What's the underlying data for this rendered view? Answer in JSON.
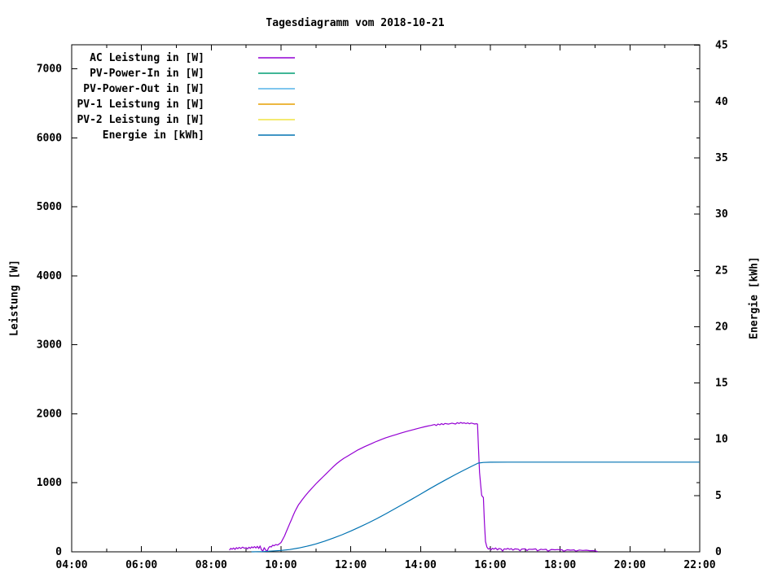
{
  "chart_data": {
    "type": "line",
    "title": "Tagesdiagramm vom 2018-10-21",
    "grid": false,
    "legend_position": "top-left-inside",
    "x_axis": {
      "range_hours": [
        4,
        22
      ],
      "major_tick_hours": [
        4,
        6,
        8,
        10,
        12,
        14,
        16,
        18,
        20,
        22
      ],
      "minor_tick_hours": [
        5,
        7,
        9,
        11,
        13,
        15,
        17,
        19,
        21
      ],
      "tick_labels": [
        "04:00",
        "06:00",
        "08:00",
        "10:00",
        "12:00",
        "14:00",
        "16:00",
        "18:00",
        "20:00",
        "22:00"
      ]
    },
    "y_left": {
      "label": "Leistung [W]",
      "ticks": [
        0,
        1000,
        2000,
        3000,
        4000,
        5000,
        6000,
        7000
      ],
      "max_value": 7348
    },
    "y_right": {
      "label": "Energie [kWh]",
      "ticks": [
        0,
        5,
        10,
        15,
        20,
        25,
        30,
        35,
        40,
        45
      ],
      "max_value": 45.05
    },
    "series": [
      {
        "name": "AC Leistung in [W]",
        "color": "#9400d3",
        "axis": "left",
        "points": [
          [
            8.52,
            25
          ],
          [
            8.56,
            50
          ],
          [
            8.6,
            38
          ],
          [
            8.64,
            55
          ],
          [
            8.68,
            34
          ],
          [
            8.72,
            60
          ],
          [
            8.76,
            45
          ],
          [
            8.8,
            64
          ],
          [
            8.85,
            48
          ],
          [
            8.9,
            68
          ],
          [
            8.95,
            52
          ],
          [
            9.0,
            60
          ],
          [
            9.04,
            42
          ],
          [
            9.08,
            66
          ],
          [
            9.12,
            50
          ],
          [
            9.16,
            72
          ],
          [
            9.2,
            58
          ],
          [
            9.24,
            76
          ],
          [
            9.28,
            55
          ],
          [
            9.32,
            80
          ],
          [
            9.36,
            48
          ],
          [
            9.4,
            85
          ],
          [
            9.44,
            30
          ],
          [
            9.48,
            12
          ],
          [
            9.52,
            60
          ],
          [
            9.56,
            25
          ],
          [
            9.6,
            10
          ],
          [
            9.64,
            55
          ],
          [
            9.68,
            78
          ],
          [
            9.72,
            70
          ],
          [
            9.76,
            95
          ],
          [
            9.8,
            88
          ],
          [
            9.85,
            105
          ],
          [
            9.9,
            98
          ],
          [
            9.95,
            115
          ],
          [
            10.0,
            135
          ],
          [
            10.05,
            180
          ],
          [
            10.1,
            230
          ],
          [
            10.15,
            290
          ],
          [
            10.2,
            350
          ],
          [
            10.25,
            410
          ],
          [
            10.3,
            470
          ],
          [
            10.35,
            530
          ],
          [
            10.4,
            585
          ],
          [
            10.45,
            635
          ],
          [
            10.5,
            680
          ],
          [
            10.55,
            715
          ],
          [
            10.6,
            750
          ],
          [
            10.7,
            815
          ],
          [
            10.8,
            875
          ],
          [
            10.9,
            930
          ],
          [
            11.0,
            985
          ],
          [
            11.1,
            1035
          ],
          [
            11.2,
            1085
          ],
          [
            11.3,
            1135
          ],
          [
            11.4,
            1185
          ],
          [
            11.5,
            1235
          ],
          [
            11.6,
            1280
          ],
          [
            11.7,
            1320
          ],
          [
            11.8,
            1355
          ],
          [
            11.9,
            1385
          ],
          [
            12.0,
            1415
          ],
          [
            12.1,
            1445
          ],
          [
            12.2,
            1475
          ],
          [
            12.3,
            1500
          ],
          [
            12.4,
            1525
          ],
          [
            12.5,
            1548
          ],
          [
            12.6,
            1570
          ],
          [
            12.7,
            1592
          ],
          [
            12.8,
            1612
          ],
          [
            12.9,
            1632
          ],
          [
            13.0,
            1652
          ],
          [
            13.1,
            1668
          ],
          [
            13.2,
            1684
          ],
          [
            13.3,
            1700
          ],
          [
            13.4,
            1715
          ],
          [
            13.5,
            1730
          ],
          [
            13.6,
            1745
          ],
          [
            13.7,
            1758
          ],
          [
            13.8,
            1772
          ],
          [
            13.9,
            1785
          ],
          [
            14.0,
            1798
          ],
          [
            14.1,
            1810
          ],
          [
            14.2,
            1822
          ],
          [
            14.3,
            1832
          ],
          [
            14.4,
            1845
          ],
          [
            14.45,
            1830
          ],
          [
            14.5,
            1852
          ],
          [
            14.55,
            1840
          ],
          [
            14.6,
            1858
          ],
          [
            14.65,
            1844
          ],
          [
            14.7,
            1860
          ],
          [
            14.8,
            1850
          ],
          [
            14.9,
            1865
          ],
          [
            15.0,
            1852
          ],
          [
            15.05,
            1872
          ],
          [
            15.1,
            1860
          ],
          [
            15.15,
            1874
          ],
          [
            15.2,
            1862
          ],
          [
            15.25,
            1870
          ],
          [
            15.3,
            1858
          ],
          [
            15.35,
            1868
          ],
          [
            15.4,
            1855
          ],
          [
            15.45,
            1866
          ],
          [
            15.5,
            1860
          ],
          [
            15.55,
            1852
          ],
          [
            15.6,
            1856
          ],
          [
            15.63,
            1850
          ],
          [
            15.66,
            1500
          ],
          [
            15.69,
            1150
          ],
          [
            15.72,
            980
          ],
          [
            15.75,
            820
          ],
          [
            15.78,
            795
          ],
          [
            15.8,
            790
          ],
          [
            15.83,
            420
          ],
          [
            15.86,
            150
          ],
          [
            15.9,
            70
          ],
          [
            15.94,
            40
          ],
          [
            15.98,
            48
          ],
          [
            16.02,
            30
          ],
          [
            16.06,
            52
          ],
          [
            16.1,
            38
          ],
          [
            16.15,
            55
          ],
          [
            16.2,
            28
          ],
          [
            16.25,
            48
          ],
          [
            16.3,
            42
          ],
          [
            16.35,
            12
          ],
          [
            16.4,
            44
          ],
          [
            16.45,
            38
          ],
          [
            16.5,
            50
          ],
          [
            16.55,
            35
          ],
          [
            16.6,
            46
          ],
          [
            16.65,
            25
          ],
          [
            16.7,
            42
          ],
          [
            16.8,
            38
          ],
          [
            16.85,
            15
          ],
          [
            16.9,
            40
          ],
          [
            17.0,
            44
          ],
          [
            17.05,
            18
          ],
          [
            17.1,
            38
          ],
          [
            17.2,
            35
          ],
          [
            17.3,
            42
          ],
          [
            17.35,
            14
          ],
          [
            17.45,
            38
          ],
          [
            17.5,
            32
          ],
          [
            17.6,
            36
          ],
          [
            17.65,
            10
          ],
          [
            17.75,
            34
          ],
          [
            17.85,
            30
          ],
          [
            17.95,
            33
          ],
          [
            18.0,
            26
          ],
          [
            18.05,
            32
          ],
          [
            18.1,
            8
          ],
          [
            18.2,
            30
          ],
          [
            18.3,
            24
          ],
          [
            18.4,
            28
          ],
          [
            18.45,
            10
          ],
          [
            18.55,
            26
          ],
          [
            18.65,
            20
          ],
          [
            18.75,
            24
          ],
          [
            18.85,
            16
          ],
          [
            18.95,
            18
          ],
          [
            19.02,
            12
          ],
          [
            19.07,
            4
          ]
        ]
      },
      {
        "name": "PV-Power-In in [W]",
        "color": "#009e73",
        "axis": "left",
        "points": []
      },
      {
        "name": "PV-Power-Out in [W]",
        "color": "#56b4e9",
        "axis": "left",
        "points": []
      },
      {
        "name": "PV-1 Leistung in [W]",
        "color": "#e69f00",
        "axis": "left",
        "points": []
      },
      {
        "name": "PV-2 Leistung in [W]",
        "color": "#f0e442",
        "axis": "left",
        "points": []
      },
      {
        "name": "Energie in [kWh]",
        "color": "#0072b2",
        "axis": "right",
        "points": [
          [
            9.15,
            0
          ],
          [
            9.5,
            0.02
          ],
          [
            10.0,
            0.12
          ],
          [
            10.25,
            0.2
          ],
          [
            10.5,
            0.33
          ],
          [
            10.75,
            0.5
          ],
          [
            11.0,
            0.7
          ],
          [
            11.25,
            0.95
          ],
          [
            11.5,
            1.22
          ],
          [
            11.75,
            1.52
          ],
          [
            12.0,
            1.85
          ],
          [
            12.25,
            2.2
          ],
          [
            12.5,
            2.57
          ],
          [
            12.75,
            2.96
          ],
          [
            13.0,
            3.37
          ],
          [
            13.25,
            3.8
          ],
          [
            13.5,
            4.24
          ],
          [
            13.75,
            4.68
          ],
          [
            14.0,
            5.13
          ],
          [
            14.25,
            5.58
          ],
          [
            14.5,
            6.02
          ],
          [
            14.75,
            6.45
          ],
          [
            15.0,
            6.87
          ],
          [
            15.25,
            7.27
          ],
          [
            15.5,
            7.66
          ],
          [
            15.65,
            7.88
          ],
          [
            15.8,
            7.94
          ],
          [
            16.0,
            7.96
          ],
          [
            16.5,
            7.97
          ],
          [
            17.0,
            7.97
          ],
          [
            18.0,
            7.97
          ],
          [
            19.0,
            7.97
          ],
          [
            20.0,
            7.97
          ],
          [
            21.0,
            7.97
          ],
          [
            22.0,
            7.97
          ]
        ]
      }
    ]
  }
}
